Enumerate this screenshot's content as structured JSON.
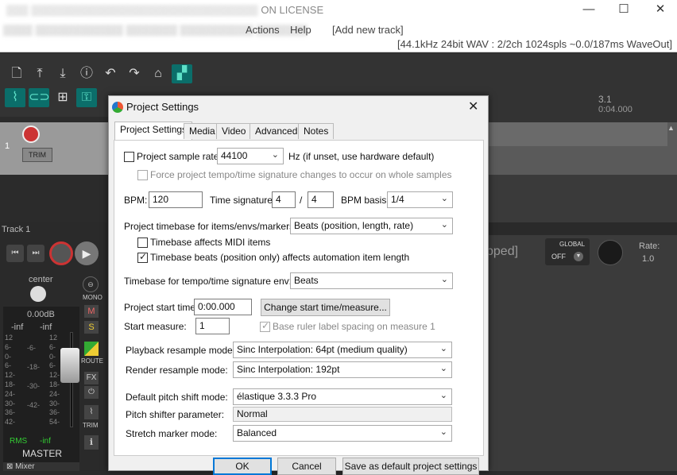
{
  "window": {
    "title": "ON LICENSE",
    "controls": {
      "minimize": "—",
      "maximize": "☐",
      "close": "✕"
    }
  },
  "menubar": {
    "items": [
      "Actions",
      "Help",
      "[Add new track]"
    ],
    "audio_status": "[44.1kHz 24bit WAV : 2/2ch 1024spls ~0.0/187ms WaveOut]"
  },
  "ruler": {
    "bar": "3.1",
    "time": "0:04.000"
  },
  "track": {
    "number": "1",
    "trim_label": "TRIM",
    "name": "Track 1"
  },
  "mixer": {
    "pan_label": "center",
    "volume": "0.00dB",
    "peak_left": "-inf",
    "peak_right": "-inf",
    "mono_label": "MONO",
    "mute_label": "M",
    "solo_label": "S",
    "route_label": "ROUTE",
    "fx_label": "FX",
    "trim_label": "TRIM",
    "rms_label": "RMS",
    "rms_value": "-inf",
    "master_label": "MASTER",
    "mixer_tab": "Mixer",
    "scale_left": [
      "12",
      "6-",
      "0-",
      "6-",
      "12-",
      "18-",
      "24-",
      "30-",
      "36-",
      "42-"
    ],
    "scale_mid": [
      "-6-",
      "-18-",
      "-30-",
      "-42-"
    ],
    "scale_right": [
      "12",
      "6-",
      "0-",
      "6-",
      "12-",
      "18-",
      "24-",
      "30-",
      "36-",
      "54-"
    ],
    "stopped_text": "pped]",
    "global_label": "GLOBAL",
    "global_value": "OFF",
    "rate_label": "Rate:",
    "rate_value": "1.0"
  },
  "dialog": {
    "title": "Project Settings",
    "close": "✕",
    "tabs": [
      "Project Settings",
      "Media",
      "Video",
      "Advanced",
      "Notes"
    ],
    "sample_rate_label": "Project sample rate:",
    "sample_rate_value": "44100",
    "sample_rate_hint": "Hz (if unset, use hardware default)",
    "force_tempo_label": "Force project tempo/time signature changes to occur on whole samples",
    "bpm_label": "BPM:",
    "bpm_value": "120",
    "time_sig_label": "Time signature:",
    "time_sig_num": "4",
    "time_sig_sep": "/",
    "time_sig_den": "4",
    "bpm_basis_label": "BPM basis:",
    "bpm_basis_value": "1/4",
    "timebase_label": "Project timebase for items/envs/markers:",
    "timebase_value": "Beats (position, length, rate)",
    "timebase_midi_label": "Timebase affects MIDI items",
    "timebase_auto_label": "Timebase beats (position only) affects automation item length",
    "tempo_env_label": "Timebase for tempo/time signature env:",
    "tempo_env_value": "Beats",
    "start_time_label": "Project start time:",
    "start_time_value": "0:00.000",
    "change_start_button": "Change start time/measure...",
    "start_measure_label": "Start measure:",
    "start_measure_value": "1",
    "base_ruler_label": "Base ruler label spacing on measure 1",
    "playback_resample_label": "Playback resample mode:",
    "playback_resample_value": "Sinc Interpolation: 64pt (medium quality)",
    "render_resample_label": "Render resample mode:",
    "render_resample_value": "Sinc Interpolation: 192pt",
    "pitch_shift_label": "Default pitch shift mode:",
    "pitch_shift_value": "élastique 3.3.3 Pro",
    "pitch_param_label": "Pitch shifter parameter:",
    "pitch_param_value": "Normal",
    "stretch_label": "Stretch marker mode:",
    "stretch_value": "Balanced",
    "ok_button": "OK",
    "cancel_button": "Cancel",
    "save_default_button": "Save as default project settings"
  }
}
